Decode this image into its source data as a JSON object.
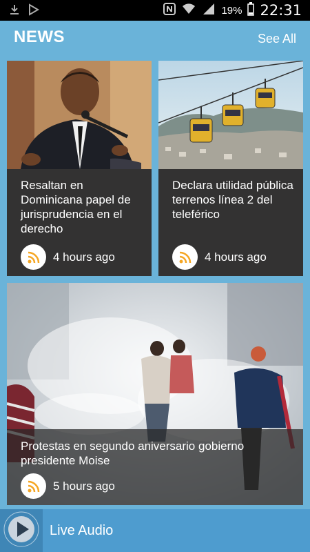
{
  "status_bar": {
    "battery": "19%",
    "time": "22:31",
    "icons": [
      "download-icon",
      "media-icon",
      "nfc-icon",
      "wifi-icon",
      "signal-icon",
      "battery-icon"
    ]
  },
  "header": {
    "title": "NEWS",
    "see_all": "See All"
  },
  "cards": [
    {
      "headline": "Resaltan en Dominicana papel de jurisprudencia en el derecho",
      "time": "4 hours ago"
    },
    {
      "headline": "Declara utilidad pública terrenos línea 2 del teleférico",
      "time": "4 hours ago"
    },
    {
      "headline": "Protestas  en segundo aniversario gobierno presidente Moise",
      "time": "5 hours ago"
    }
  ],
  "player": {
    "label": "Live Audio"
  },
  "colors": {
    "accent": "#6ab3d9",
    "card_bg": "#333232",
    "rss": "#f5a623"
  }
}
